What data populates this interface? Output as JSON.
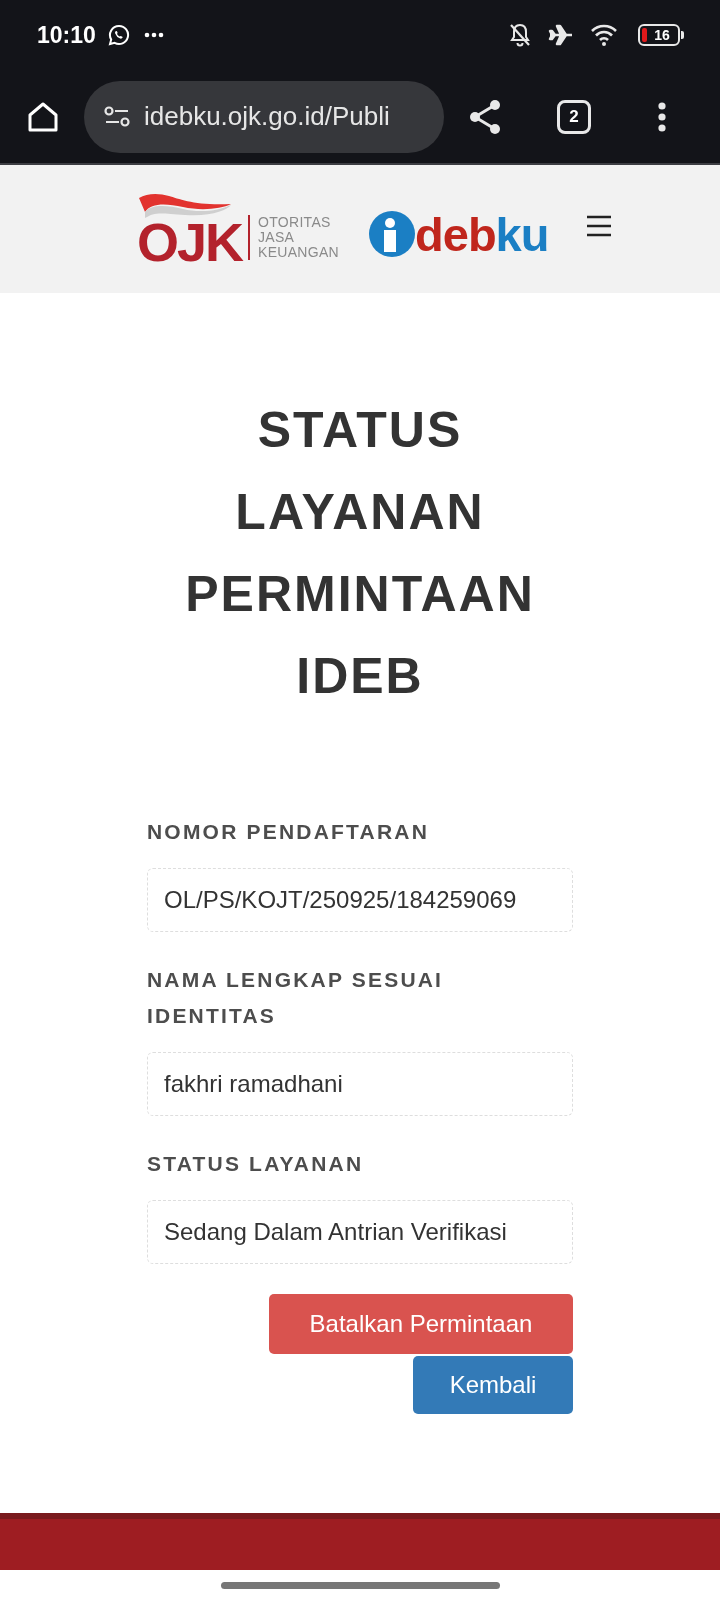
{
  "status_bar": {
    "time": "10:10",
    "battery": "16"
  },
  "browser": {
    "url": "idebku.ojk.go.id/Publi",
    "tab_count": "2"
  },
  "header": {
    "ojk_logo": {
      "letters": "OJK",
      "lines": [
        "OTORITAS",
        "JASA",
        "KEUANGAN"
      ]
    },
    "idebku_logo": {
      "parts": [
        {
          "text": "deb",
          "color": "#c0261c"
        },
        {
          "text": "ku",
          "color": "#1b7fc4"
        }
      ]
    }
  },
  "page": {
    "title": "STATUS LAYANAN PERMINTAAN IDEB",
    "fields": [
      {
        "label": "NOMOR PENDAFTARAN",
        "value": "OL/PS/KOJT/250925/184259069"
      },
      {
        "label": "NAMA LENGKAP SESUAI IDENTITAS",
        "value": "fakhri ramadhani"
      },
      {
        "label": "STATUS LAYANAN",
        "value": "Sedang Dalam Antrian Verifikasi"
      }
    ],
    "buttons": [
      {
        "label": "Batalkan Permintaan",
        "kind": "danger"
      },
      {
        "label": "Kembali",
        "kind": "primary"
      }
    ]
  }
}
